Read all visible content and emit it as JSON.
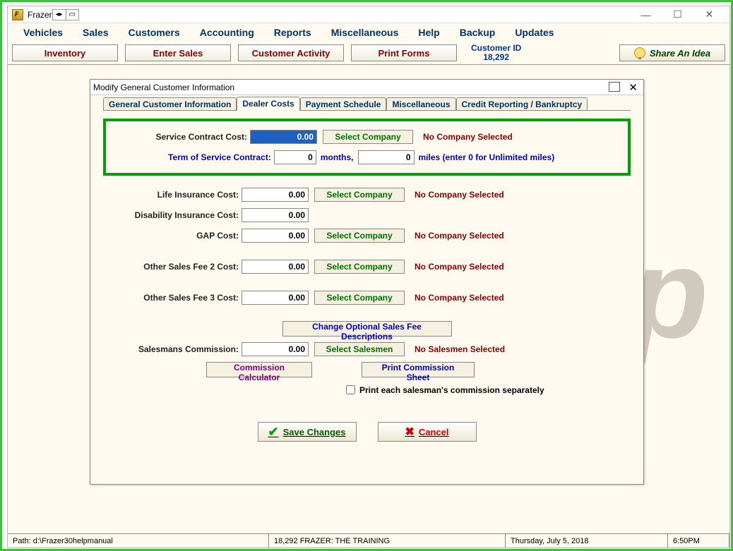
{
  "window_title": "Frazer",
  "menu": [
    "Vehicles",
    "Sales",
    "Customers",
    "Accounting",
    "Reports",
    "Miscellaneous",
    "Help",
    "Backup",
    "Updates"
  ],
  "toolbar": {
    "inventory": "Inventory",
    "enter_sales": "Enter Sales",
    "customer_activity": "Customer Activity",
    "print_forms": "Print Forms",
    "customer_id_label": "Customer ID",
    "customer_id_value": "18,292",
    "share": "Share An Idea"
  },
  "modal": {
    "title": "Modify General Customer Information",
    "tabs": [
      "General Customer Information",
      "Dealer Costs",
      "Payment Schedule",
      "Miscellaneous",
      "Credit Reporting / Bankruptcy"
    ],
    "active_tab": 1,
    "fields": {
      "service_contract": {
        "label": "Service Contract Cost:",
        "value": "0.00",
        "select": "Select Company",
        "status": "No Company Selected"
      },
      "term": {
        "label": "Term of Service Contract:",
        "months": "0",
        "months_unit": "months,",
        "miles": "0",
        "miles_unit": "miles (enter 0 for Unlimited miles)"
      },
      "life_insurance": {
        "label": "Life Insurance Cost:",
        "value": "0.00",
        "select": "Select Company",
        "status": "No Company Selected"
      },
      "disability": {
        "label": "Disability Insurance Cost:",
        "value": "0.00"
      },
      "gap": {
        "label": "GAP Cost:",
        "value": "0.00",
        "select": "Select Company",
        "status": "No Company Selected"
      },
      "other2": {
        "label": "Other Sales Fee 2 Cost:",
        "value": "0.00",
        "select": "Select Company",
        "status": "No Company Selected"
      },
      "other3": {
        "label": "Other Sales Fee 3 Cost:",
        "value": "0.00",
        "select": "Select Company",
        "status": "No Company Selected"
      },
      "change_desc": "Change Optional Sales Fee Descriptions",
      "commission": {
        "label": "Salesmans Commission:",
        "value": "0.00",
        "select": "Select Salesmen",
        "status": "No Salesmen Selected"
      },
      "calc": "Commission Calculator",
      "print_sheet": "Print Commission Sheet",
      "print_sep": "Print each salesman's commission separately"
    },
    "save": "Save Changes",
    "cancel": "Cancel"
  },
  "statusbar": {
    "path": "Path: d:\\Frazer30helpmanual",
    "mid": "18,292  FRAZER: THE TRAINING",
    "date": "Thursday, July  5, 2018",
    "time": "6:50PM"
  }
}
